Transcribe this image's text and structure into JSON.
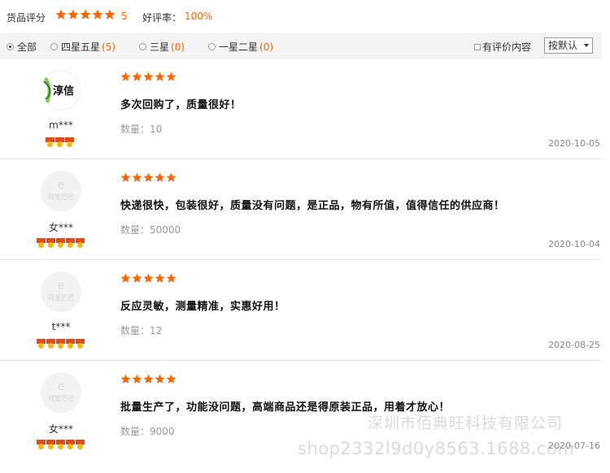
{
  "header": {
    "rating_label": "货品评分",
    "score": "5",
    "good_rate_label": "好评率：",
    "good_rate": "100%"
  },
  "filters": {
    "all": "全部",
    "four_five": "四星五星",
    "four_five_count": "(5)",
    "three": "三星",
    "three_count": "(0)",
    "one_two": "一星二星",
    "one_two_count": "(0)",
    "has_content": "有评价内容",
    "sort": "按默认"
  },
  "colors": {
    "accent": "#ff6600",
    "star": "#ff6600"
  },
  "reviews": [
    {
      "avatar_icon": "taobao-brand-avatar-icon",
      "avatar_text": "淳信",
      "user": "m***",
      "medals": 3,
      "content": "多次回购了，质量很好！",
      "qty": "数量：10",
      "date": "2020-10-05"
    },
    {
      "avatar_icon": "alibaba-default-avatar-icon",
      "avatar_text": "阿里巴巴",
      "user": "女***",
      "medals": 5,
      "content": "快递很快，包装很好，质量没有问题，是正品，物有所值，值得信任的供应商！",
      "qty": "数量：50000",
      "date": "2020-10-04"
    },
    {
      "avatar_icon": "alibaba-default-avatar-icon",
      "avatar_text": "阿里巴巴",
      "user": "t***",
      "medals": 5,
      "content": "反应灵敏，测量精准，实惠好用！",
      "qty": "数量：12",
      "date": "2020-08-25"
    },
    {
      "avatar_icon": "alibaba-default-avatar-icon",
      "avatar_text": "阿里巴巴",
      "user": "女***",
      "medals": 5,
      "content": "批量生产了，功能没问题，高端商品还是得原装正品，用着才放心！",
      "qty": "数量：9000",
      "date": "2020-07-16"
    }
  ],
  "watermark": {
    "company": "深圳市佰典旺科技有限公司",
    "url": "shop2332l9d0y8563.1688.com"
  }
}
